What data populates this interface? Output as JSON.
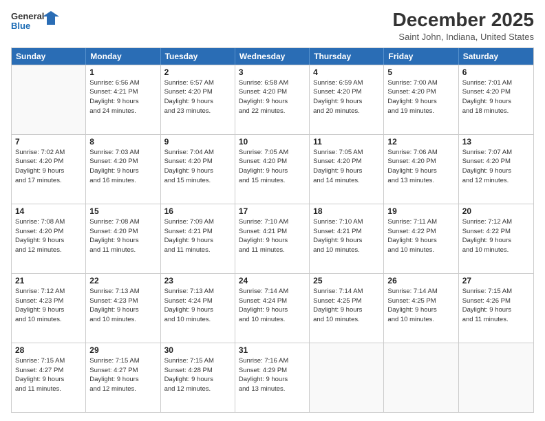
{
  "header": {
    "logo_line1": "General",
    "logo_line2": "Blue",
    "title": "December 2025",
    "subtitle": "Saint John, Indiana, United States"
  },
  "weekdays": [
    "Sunday",
    "Monday",
    "Tuesday",
    "Wednesday",
    "Thursday",
    "Friday",
    "Saturday"
  ],
  "weeks": [
    [
      {
        "day": "",
        "info": ""
      },
      {
        "day": "1",
        "info": "Sunrise: 6:56 AM\nSunset: 4:21 PM\nDaylight: 9 hours\nand 24 minutes."
      },
      {
        "day": "2",
        "info": "Sunrise: 6:57 AM\nSunset: 4:20 PM\nDaylight: 9 hours\nand 23 minutes."
      },
      {
        "day": "3",
        "info": "Sunrise: 6:58 AM\nSunset: 4:20 PM\nDaylight: 9 hours\nand 22 minutes."
      },
      {
        "day": "4",
        "info": "Sunrise: 6:59 AM\nSunset: 4:20 PM\nDaylight: 9 hours\nand 20 minutes."
      },
      {
        "day": "5",
        "info": "Sunrise: 7:00 AM\nSunset: 4:20 PM\nDaylight: 9 hours\nand 19 minutes."
      },
      {
        "day": "6",
        "info": "Sunrise: 7:01 AM\nSunset: 4:20 PM\nDaylight: 9 hours\nand 18 minutes."
      }
    ],
    [
      {
        "day": "7",
        "info": "Sunrise: 7:02 AM\nSunset: 4:20 PM\nDaylight: 9 hours\nand 17 minutes."
      },
      {
        "day": "8",
        "info": "Sunrise: 7:03 AM\nSunset: 4:20 PM\nDaylight: 9 hours\nand 16 minutes."
      },
      {
        "day": "9",
        "info": "Sunrise: 7:04 AM\nSunset: 4:20 PM\nDaylight: 9 hours\nand 15 minutes."
      },
      {
        "day": "10",
        "info": "Sunrise: 7:05 AM\nSunset: 4:20 PM\nDaylight: 9 hours\nand 15 minutes."
      },
      {
        "day": "11",
        "info": "Sunrise: 7:05 AM\nSunset: 4:20 PM\nDaylight: 9 hours\nand 14 minutes."
      },
      {
        "day": "12",
        "info": "Sunrise: 7:06 AM\nSunset: 4:20 PM\nDaylight: 9 hours\nand 13 minutes."
      },
      {
        "day": "13",
        "info": "Sunrise: 7:07 AM\nSunset: 4:20 PM\nDaylight: 9 hours\nand 12 minutes."
      }
    ],
    [
      {
        "day": "14",
        "info": "Sunrise: 7:08 AM\nSunset: 4:20 PM\nDaylight: 9 hours\nand 12 minutes."
      },
      {
        "day": "15",
        "info": "Sunrise: 7:08 AM\nSunset: 4:20 PM\nDaylight: 9 hours\nand 11 minutes."
      },
      {
        "day": "16",
        "info": "Sunrise: 7:09 AM\nSunset: 4:21 PM\nDaylight: 9 hours\nand 11 minutes."
      },
      {
        "day": "17",
        "info": "Sunrise: 7:10 AM\nSunset: 4:21 PM\nDaylight: 9 hours\nand 11 minutes."
      },
      {
        "day": "18",
        "info": "Sunrise: 7:10 AM\nSunset: 4:21 PM\nDaylight: 9 hours\nand 10 minutes."
      },
      {
        "day": "19",
        "info": "Sunrise: 7:11 AM\nSunset: 4:22 PM\nDaylight: 9 hours\nand 10 minutes."
      },
      {
        "day": "20",
        "info": "Sunrise: 7:12 AM\nSunset: 4:22 PM\nDaylight: 9 hours\nand 10 minutes."
      }
    ],
    [
      {
        "day": "21",
        "info": "Sunrise: 7:12 AM\nSunset: 4:23 PM\nDaylight: 9 hours\nand 10 minutes."
      },
      {
        "day": "22",
        "info": "Sunrise: 7:13 AM\nSunset: 4:23 PM\nDaylight: 9 hours\nand 10 minutes."
      },
      {
        "day": "23",
        "info": "Sunrise: 7:13 AM\nSunset: 4:24 PM\nDaylight: 9 hours\nand 10 minutes."
      },
      {
        "day": "24",
        "info": "Sunrise: 7:14 AM\nSunset: 4:24 PM\nDaylight: 9 hours\nand 10 minutes."
      },
      {
        "day": "25",
        "info": "Sunrise: 7:14 AM\nSunset: 4:25 PM\nDaylight: 9 hours\nand 10 minutes."
      },
      {
        "day": "26",
        "info": "Sunrise: 7:14 AM\nSunset: 4:25 PM\nDaylight: 9 hours\nand 10 minutes."
      },
      {
        "day": "27",
        "info": "Sunrise: 7:15 AM\nSunset: 4:26 PM\nDaylight: 9 hours\nand 11 minutes."
      }
    ],
    [
      {
        "day": "28",
        "info": "Sunrise: 7:15 AM\nSunset: 4:27 PM\nDaylight: 9 hours\nand 11 minutes."
      },
      {
        "day": "29",
        "info": "Sunrise: 7:15 AM\nSunset: 4:27 PM\nDaylight: 9 hours\nand 12 minutes."
      },
      {
        "day": "30",
        "info": "Sunrise: 7:15 AM\nSunset: 4:28 PM\nDaylight: 9 hours\nand 12 minutes."
      },
      {
        "day": "31",
        "info": "Sunrise: 7:16 AM\nSunset: 4:29 PM\nDaylight: 9 hours\nand 13 minutes."
      },
      {
        "day": "",
        "info": ""
      },
      {
        "day": "",
        "info": ""
      },
      {
        "day": "",
        "info": ""
      }
    ]
  ]
}
